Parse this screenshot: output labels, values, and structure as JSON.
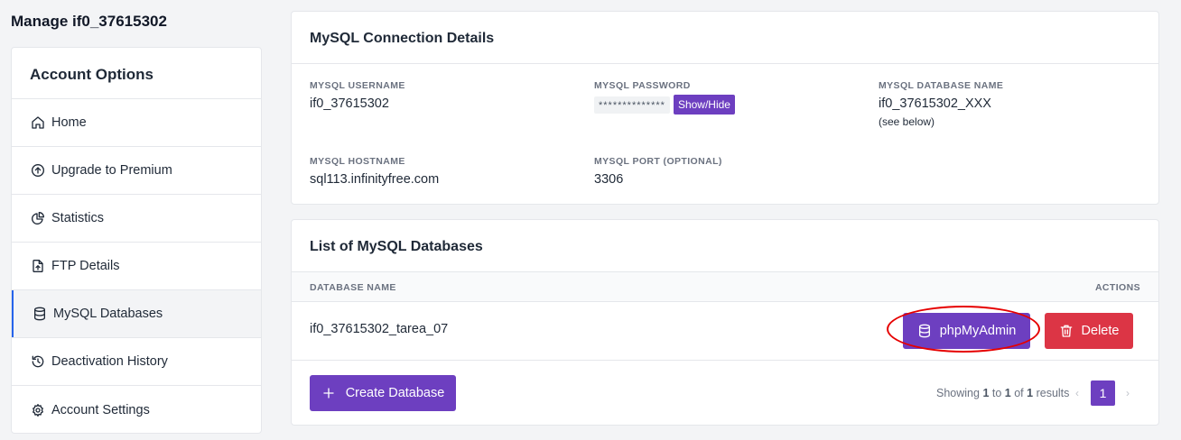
{
  "page_title": "Manage if0_37615302",
  "sidebar": {
    "header": "Account Options",
    "items": [
      {
        "label": "Home",
        "icon": "home-icon"
      },
      {
        "label": "Upgrade to Premium",
        "icon": "arrow-up-circle-icon"
      },
      {
        "label": "Statistics",
        "icon": "pie-chart-icon"
      },
      {
        "label": "FTP Details",
        "icon": "file-upload-icon"
      },
      {
        "label": "MySQL Databases",
        "icon": "database-icon",
        "active": true
      },
      {
        "label": "Deactivation History",
        "icon": "history-icon"
      },
      {
        "label": "Account Settings",
        "icon": "gear-icon"
      }
    ]
  },
  "connection": {
    "title": "MySQL Connection Details",
    "username_label": "MYSQL USERNAME",
    "username": "if0_37615302",
    "password_label": "MYSQL PASSWORD",
    "password_mask": "**************",
    "show_hide": "Show/Hide",
    "dbname_label": "MYSQL DATABASE NAME",
    "dbname": "if0_37615302_XXX",
    "dbname_note": "(see below)",
    "hostname_label": "MYSQL HOSTNAME",
    "hostname": "sql113.infinityfree.com",
    "port_label": "MYSQL PORT (OPTIONAL)",
    "port": "3306"
  },
  "databases": {
    "title": "List of MySQL Databases",
    "col_name": "DATABASE NAME",
    "col_actions": "ACTIONS",
    "rows": [
      {
        "name": "if0_37615302_tarea_07"
      }
    ],
    "phpmyadmin_label": "phpMyAdmin",
    "delete_label": "Delete",
    "create_label": "Create Database",
    "results": {
      "prefix": "Showing",
      "from": "1",
      "to_word": "to",
      "to": "1",
      "of_word": "of",
      "total": "1",
      "suffix": "results"
    },
    "pagination": {
      "prev": "‹",
      "current": "1",
      "next": "›"
    }
  },
  "colors": {
    "accent": "#6d3fc0",
    "danger": "#dc3545",
    "highlight_circle": "#e60000",
    "active_bar": "#2563eb"
  }
}
